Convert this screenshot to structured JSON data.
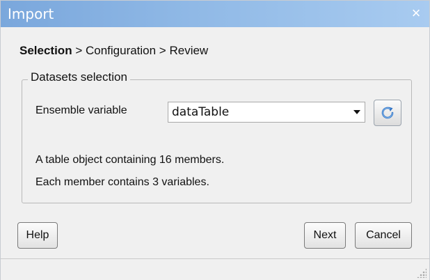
{
  "window": {
    "title": "Import",
    "close_glyph": "×"
  },
  "steps": {
    "current": "Selection",
    "rest": " > Configuration > Review"
  },
  "group": {
    "title": "Datasets selection",
    "ensemble_label": "Ensemble variable",
    "ensemble_value": "dataTable",
    "description_line1": "A table object containing 16 members.",
    "description_line2": "Each member contains 3 variables."
  },
  "buttons": {
    "help": "Help",
    "next": "Next",
    "cancel": "Cancel"
  },
  "icons": {
    "refresh": "refresh-icon",
    "dropdown": "chevron-down-icon",
    "resize": "resize-grip-icon"
  },
  "colors": {
    "titlebar": "#7aa7dc",
    "window_bg": "#f0f0f0"
  }
}
